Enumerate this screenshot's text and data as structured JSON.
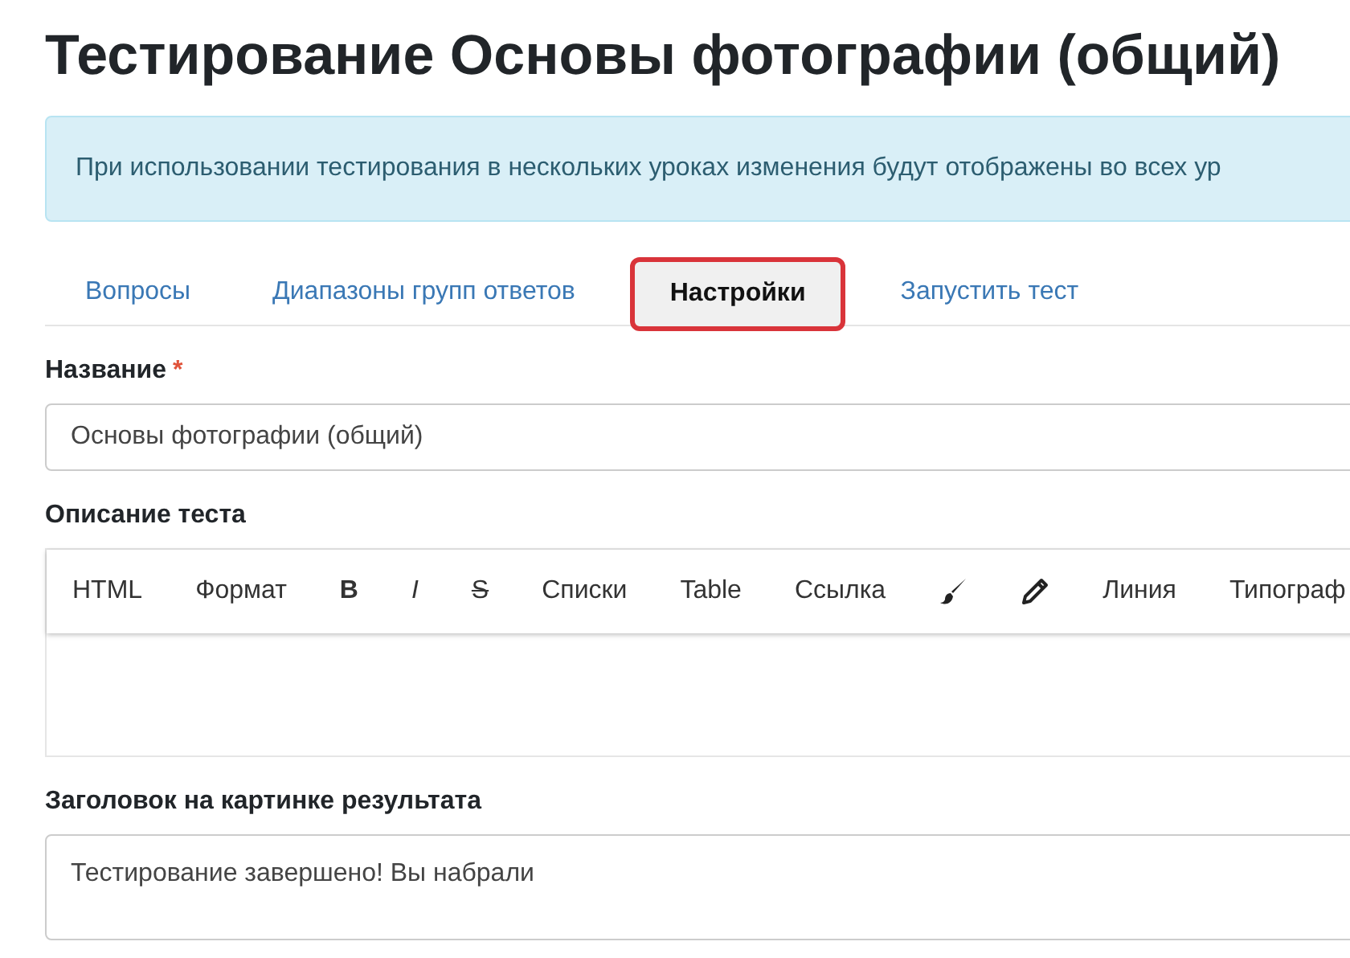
{
  "page_title": "Тестирование Основы фотографии (общий)",
  "alert": "При использовании тестирования в нескольких уроках изменения будут отображены во всех ур",
  "tabs": [
    {
      "label": "Вопросы",
      "selected": false
    },
    {
      "label": "Диапазоны групп ответов",
      "selected": false
    },
    {
      "label": "Настройки",
      "selected": true
    },
    {
      "label": "Запустить тест",
      "selected": false
    }
  ],
  "name_field": {
    "label": "Название",
    "required": true,
    "required_mark": "*",
    "value": "Основы фотографии (общий)"
  },
  "description": {
    "label": "Описание теста",
    "toolbar": [
      {
        "kind": "text",
        "label": "HTML"
      },
      {
        "kind": "text",
        "label": "Формат"
      },
      {
        "kind": "bold",
        "label": "B"
      },
      {
        "kind": "italic",
        "label": "I"
      },
      {
        "kind": "strike",
        "label": "S"
      },
      {
        "kind": "text",
        "label": "Списки"
      },
      {
        "kind": "text",
        "label": "Table"
      },
      {
        "kind": "text",
        "label": "Ссылка"
      },
      {
        "kind": "brush"
      },
      {
        "kind": "pencil"
      },
      {
        "kind": "text",
        "label": "Линия"
      },
      {
        "kind": "text",
        "label": "Типограф"
      }
    ]
  },
  "result_title_field": {
    "label": "Заголовок на картинке результата",
    "value": "Тестирование завершено! Вы набрали"
  }
}
